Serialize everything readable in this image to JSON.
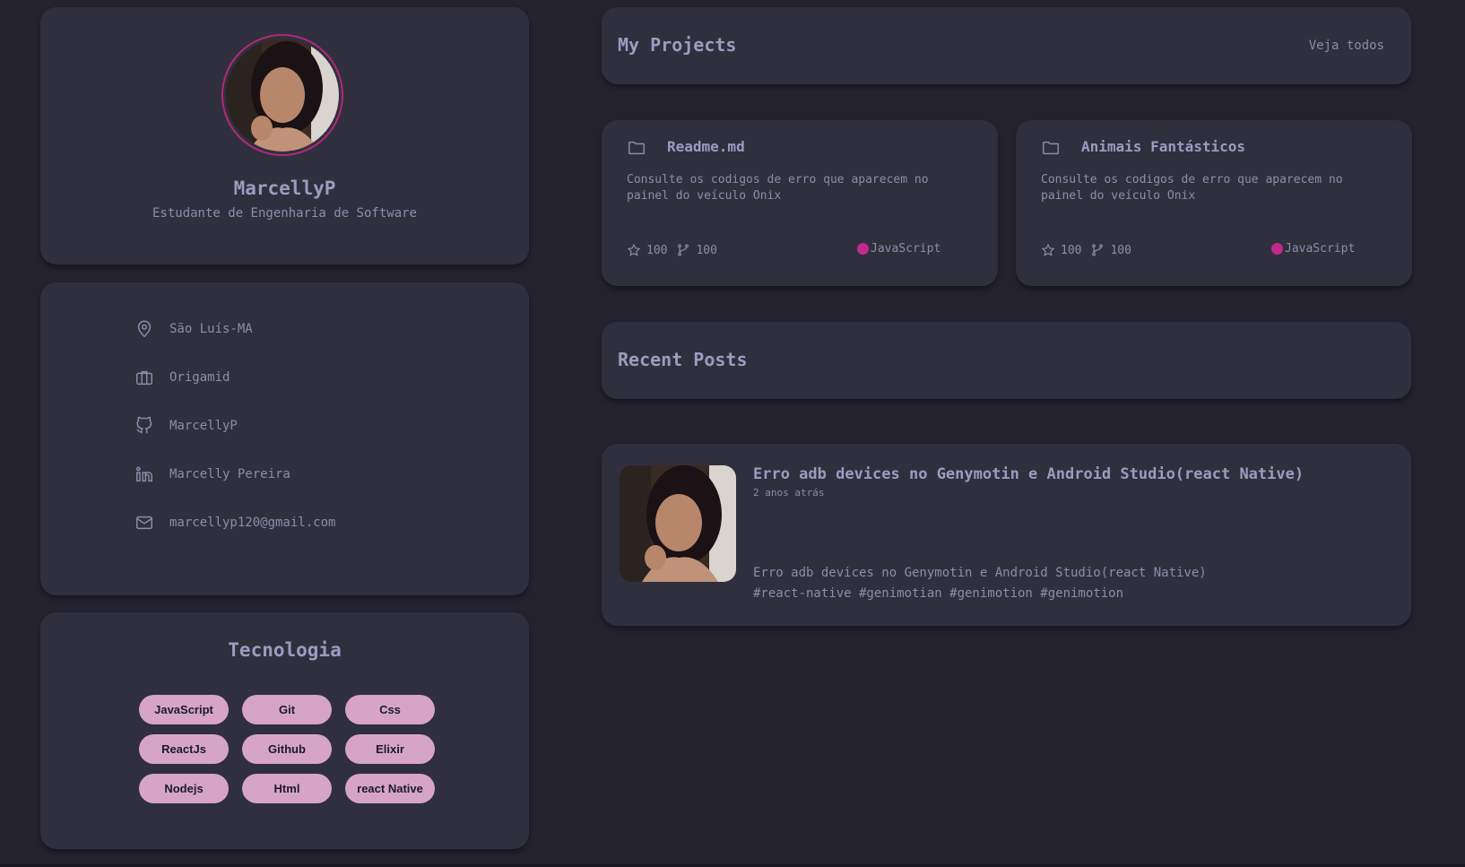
{
  "profile": {
    "name": "MarcellyP",
    "role": "Estudante de Engenharia de Software"
  },
  "info": {
    "location": "São Luís-MA",
    "company": "Origamid",
    "github": "MarcellyP",
    "linkedin": "Marcelly Pereira",
    "email": "marcellyp120@gmail.com"
  },
  "tech": {
    "title": "Tecnologia",
    "chips": [
      "JavaScript",
      "Git",
      "Css",
      "ReactJs",
      "Github",
      "Elixir",
      "Nodejs",
      "Html",
      "react Native"
    ]
  },
  "projects": {
    "title": "My Projects",
    "see_all": "Veja todos",
    "items": [
      {
        "name": "Readme.md",
        "description": "Consulte os codigos de erro que aparecem no painel do veículo Onix",
        "stars": "100",
        "forks": "100",
        "language": "JavaScript"
      },
      {
        "name": "Animais Fantásticos",
        "description": "Consulte os codigos de erro que aparecem no painel do veículo Onix",
        "stars": "100",
        "forks": "100",
        "language": "JavaScript"
      }
    ]
  },
  "posts": {
    "title": "Recent Posts",
    "items": [
      {
        "title": "Erro adb devices no Genymotin e Android Studio(react Native)",
        "date": "2 anos atrás",
        "summary": "Erro adb devices no Genymotin e Android Studio(react Native)",
        "tags": "#react-native #genimotian #genimotion #genimotion"
      }
    ]
  },
  "colors": {
    "background": "#24222e",
    "card": "#302f3e",
    "accent": "#c4288c",
    "chip": "#d6a5c6"
  }
}
